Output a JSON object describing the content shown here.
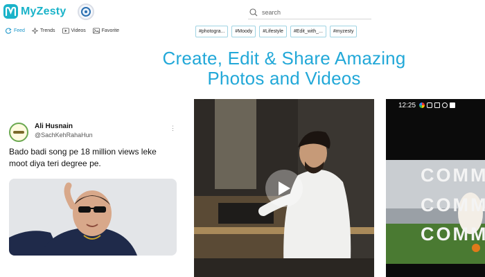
{
  "header": {
    "brand": "MyZesty",
    "brand_color": "#1ab3c9"
  },
  "nav": {
    "items": [
      {
        "label": "Feed",
        "icon": "refresh-icon",
        "active": true
      },
      {
        "label": "Trends",
        "icon": "sparkle-icon",
        "active": false
      },
      {
        "label": "Videos",
        "icon": "video-icon",
        "active": false
      },
      {
        "label": "Favorite",
        "icon": "image-icon",
        "active": false
      }
    ]
  },
  "search": {
    "placeholder": "search"
  },
  "tags": [
    "#photogra...",
    "#Moody",
    "#Lifestyle",
    "#Edit_with_...",
    "#myzesty"
  ],
  "hero": {
    "line1": "Create, Edit & Share Amazing",
    "line2": "Photos and Videos",
    "color": "#22a8d8"
  },
  "tweet": {
    "name": "Ali Husnain",
    "handle": "@SachKehRahaHun",
    "text": "Bado badi song pe 18 million views leke moot diya teri degree pe."
  },
  "video_card_2": {
    "status_time": "12:25",
    "overlay_words": [
      "COMME",
      "COMM",
      "COMME"
    ]
  }
}
